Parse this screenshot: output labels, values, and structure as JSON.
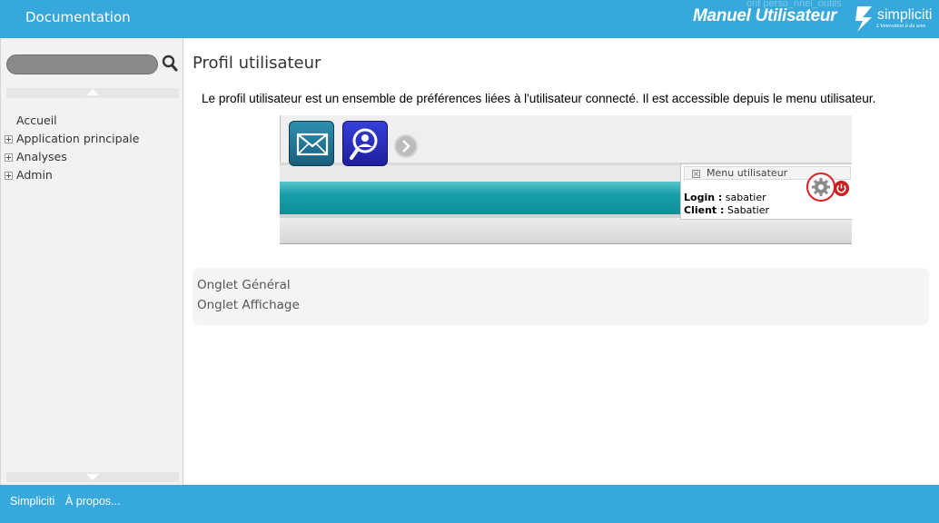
{
  "header": {
    "doc_title": "Documentation",
    "ghost_text": "ont perso_nnel_outils",
    "manual_title": "Manuel Utilisateur",
    "logo": {
      "word": "simpliciti",
      "tagline": "L'innovation à du sens",
      "mark_icon": "simpliciti-logo-icon"
    },
    "brand_color": "#36a8dc"
  },
  "sidebar": {
    "search": {
      "value": "",
      "placeholder": ""
    },
    "nav": [
      {
        "label": "Accueil",
        "expandable": false
      },
      {
        "label": "Application principale",
        "expandable": true
      },
      {
        "label": "Analyses",
        "expandable": true
      },
      {
        "label": "Admin",
        "expandable": true
      }
    ]
  },
  "main": {
    "title": "Profil utilisateur",
    "intro": "Le profil utilisateur est un ensemble de préférences liées à l'utilisateur connecté. Il est accessible depuis le menu utilisateur.",
    "screenshot": {
      "menu_title": "Menu utilisateur",
      "login_label": "Login :",
      "login_value": "sabatier",
      "client_label": "Client :",
      "client_value": "Sabatier",
      "highlight_color": "#d8232a",
      "icons": [
        "mail-icon",
        "user-search-icon",
        "next-arrow-icon",
        "gear-icon",
        "power-icon"
      ]
    },
    "sections": [
      {
        "label": "Onglet Général"
      },
      {
        "label": "Onglet Affichage"
      }
    ]
  },
  "footer": {
    "links": [
      "Simpliciti",
      "À propos..."
    ]
  }
}
